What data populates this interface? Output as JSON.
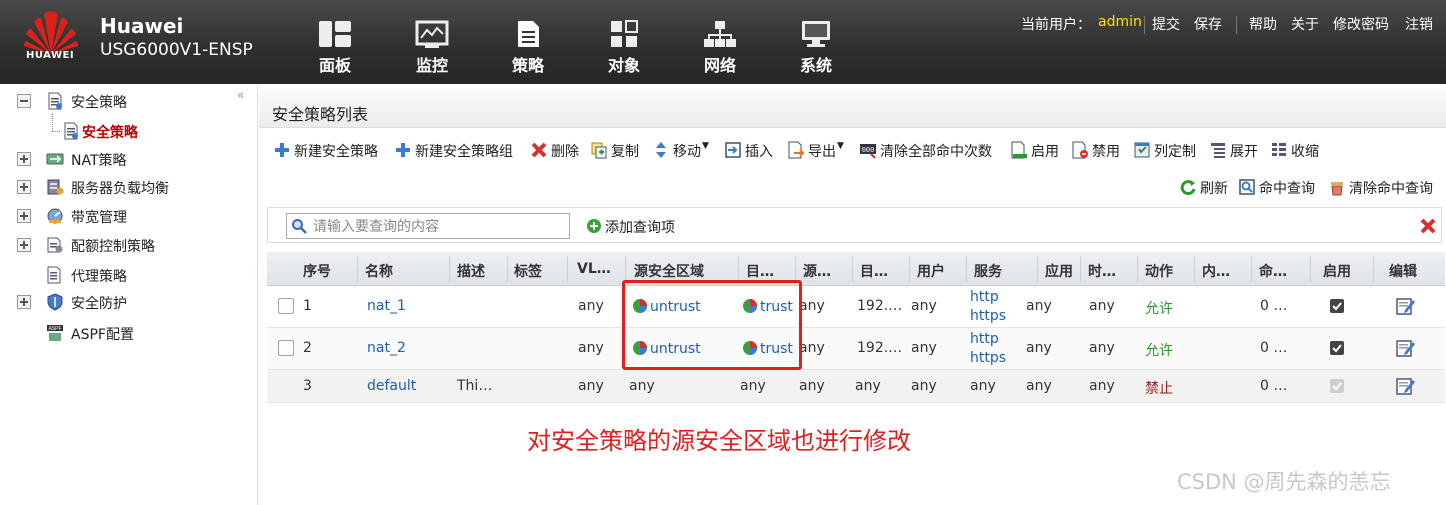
{
  "header": {
    "brand": "Huawei",
    "model": "USG6000V1-ENSP",
    "logo_text": "HUAWEI",
    "nav": [
      {
        "label": "面板",
        "icon": "dashboard-icon"
      },
      {
        "label": "监控",
        "icon": "monitor-icon"
      },
      {
        "label": "策略",
        "icon": "policy-icon"
      },
      {
        "label": "对象",
        "icon": "object-icon"
      },
      {
        "label": "网络",
        "icon": "network-icon"
      },
      {
        "label": "系统",
        "icon": "system-icon"
      }
    ],
    "current_user_label": "当前用户：",
    "current_user": "admin",
    "links": [
      "提交",
      "保存",
      "帮助",
      "关于",
      "修改密码",
      "注销"
    ]
  },
  "sidebar": {
    "items": [
      {
        "label": "安全策略",
        "expander": "minus",
        "icon": "policy-icon"
      },
      {
        "label": "安全策略",
        "expander": "none",
        "icon": "policy-icon",
        "selected": true
      },
      {
        "label": "NAT策略",
        "expander": "plus",
        "icon": "nat-icon"
      },
      {
        "label": "服务器负载均衡",
        "expander": "plus",
        "icon": "server-icon"
      },
      {
        "label": "带宽管理",
        "expander": "plus",
        "icon": "bandwidth-icon"
      },
      {
        "label": "配额控制策略",
        "expander": "plus",
        "icon": "quota-icon"
      },
      {
        "label": "代理策略",
        "expander": "none",
        "icon": "proxy-icon"
      },
      {
        "label": "安全防护",
        "expander": "plus",
        "icon": "shield-icon"
      },
      {
        "label": "ASPF配置",
        "expander": "none",
        "icon": "aspf-icon"
      }
    ],
    "collapse_glyph": "«"
  },
  "main": {
    "title": "安全策略列表",
    "toolbar": {
      "new_policy": "新建安全策略",
      "new_group": "新建安全策略组",
      "delete": "删除",
      "copy": "复制",
      "move": "移动",
      "insert": "插入",
      "export": "导出",
      "clear_hits": "清除全部命中次数",
      "enable": "启用",
      "disable": "禁用",
      "customize": "列定制",
      "expand": "展开",
      "collapse": "收缩",
      "refresh": "刷新",
      "hit_query": "命中查询",
      "clear_hit_query": "清除命中查询"
    },
    "search": {
      "placeholder": "请输入要查询的内容",
      "add_query": "添加查询项"
    },
    "columns": [
      "序号",
      "名称",
      "描述",
      "标签",
      "VL…",
      "源安全区域",
      "目…",
      "源…",
      "目…",
      "用户",
      "服务",
      "应用",
      "时…",
      "动作",
      "内…",
      "命…",
      "启用",
      "编辑"
    ],
    "rows": [
      {
        "id": "1",
        "name": "nat_1",
        "desc": "",
        "tag": "",
        "vlan": "any",
        "src_zone": "untrust",
        "dst_zone": "trust",
        "src": "any",
        "dst": "192.…",
        "user": "any",
        "service": [
          "http",
          "https"
        ],
        "app": "any",
        "time": "any",
        "action": "允许",
        "content": "",
        "hits": "0 …",
        "enabled": true
      },
      {
        "id": "2",
        "name": "nat_2",
        "desc": "",
        "tag": "",
        "vlan": "any",
        "src_zone": "untrust",
        "dst_zone": "trust",
        "src": "any",
        "dst": "192.…",
        "user": "any",
        "service": [
          "http",
          "https"
        ],
        "app": "any",
        "time": "any",
        "action": "允许",
        "content": "",
        "hits": "0 …",
        "enabled": true
      },
      {
        "id": "3",
        "name": "default",
        "desc": "Thi…",
        "tag": "",
        "vlan": "any",
        "src_zone": "any",
        "dst_zone": "any",
        "src": "any",
        "dst": "any",
        "user": "any",
        "service": [
          "any"
        ],
        "app": "any",
        "time": "any",
        "action": "禁止",
        "content": "",
        "hits": "0 …",
        "enabled": true
      }
    ]
  },
  "annotation": "对安全策略的源安全区域也进行修改",
  "watermark": "CSDN @周先森的恙忘",
  "colors": {
    "header_bg": "#2e2e2e",
    "user_name": "#ffe000",
    "link": "#1a5eb8",
    "permit": "#2a9a2a",
    "deny": "#a01818",
    "annotation": "#e02020",
    "selected_item": "#c00000"
  }
}
